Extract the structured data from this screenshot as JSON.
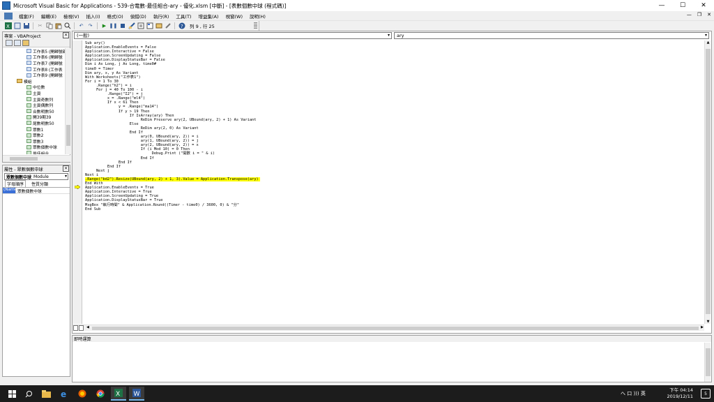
{
  "window": {
    "title": "Microsoft Visual Basic for Applications - 539-合電數-最佳組合-ary - 優化.xlsm [中斷] - [表數個數中球 (程式碼)]",
    "controls": [
      "—",
      "☐",
      "✕"
    ]
  },
  "menubar": {
    "items": [
      "檔案(F)",
      "編輯(E)",
      "檢視(V)",
      "插入(I)",
      "格式(O)",
      "偵錯(D)",
      "執行(R)",
      "工具(T)",
      "增益集(A)",
      "視窗(W)",
      "說明(H)"
    ],
    "mdi_controls": [
      "—",
      "❐",
      "✕"
    ]
  },
  "toolbar": {
    "position_text": "列 9 , 行 25"
  },
  "project_pane": {
    "title": "專案 - VBAProject",
    "tree": [
      {
        "label": "工作表5 (開歸號碼",
        "kind": "sheet"
      },
      {
        "label": "工作表6 (開歸號",
        "kind": "sheet"
      },
      {
        "label": "工作表7 (開歸號",
        "kind": "sheet"
      },
      {
        "label": "工作表8 (工作表",
        "kind": "sheet"
      },
      {
        "label": "工作表9 (開歸號",
        "kind": "sheet"
      },
      {
        "label": "模組",
        "kind": "folder"
      },
      {
        "label": "中位數",
        "kind": "module"
      },
      {
        "label": "主頁",
        "kind": "module"
      },
      {
        "label": "主頁奇數列",
        "kind": "module"
      },
      {
        "label": "主頁偶數列",
        "kind": "module"
      },
      {
        "label": "合數明數50",
        "kind": "module"
      },
      {
        "label": "開39期39",
        "kind": "module"
      },
      {
        "label": "尾數明數50",
        "kind": "module"
      },
      {
        "label": "眾數1",
        "kind": "module"
      },
      {
        "label": "眾數2",
        "kind": "module"
      },
      {
        "label": "眾數3",
        "kind": "module"
      },
      {
        "label": "眾數個數中球",
        "kind": "module"
      },
      {
        "label": "最佳組合",
        "kind": "module"
      }
    ]
  },
  "properties_pane": {
    "title": "屬性 - 眾數個數中球",
    "object_name": "眾數個數中球",
    "object_type": "Module",
    "tabs": [
      "字母順序",
      "性質分類"
    ],
    "row_key": "(Name)",
    "row_value": "眾數個數中球"
  },
  "code_window": {
    "object_combo": "(一般)",
    "proc_combo": "ary",
    "lines": [
      "Sub ary()",
      "Application.EnableEvents = False",
      "Application.Interactive = False",
      "Application.ScreenUpdating = False",
      "Application.DisplayStatusBar = False",
      "Dim i As Long, j As Long, time0#",
      "time0 = Timer",
      "Dim ary, x, y As Variant",
      "With Worksheets(\"工作表1\")",
      "For i = 1 To 30",
      "     .Range(\"h2\") = i",
      "     For j = 40 To 100 - i",
      "          .Range(\"I2\") = j",
      "          x = .Range(\"ml4\")",
      "          If x < 61 Then",
      "               y = .Range(\"ma14\")",
      "               If y > 19 Then",
      "                    If IsArray(ary) Then",
      "                         ReDim Preserve ary(2, UBound(ary, 2) + 1) As Variant",
      "                    Else",
      "                         ReDim ary(2, 0) As Variant",
      "                    End If",
      "                         ary(0, UBound(ary, 2)) = i",
      "                         ary(1, UBound(ary, 2)) = j",
      "                         ary(2, UBound(ary, 2)) = x",
      "                         If (i Mod 10) = 0 Then",
      "                              Debug.Print (\"開數 i = \" & i)",
      "                         End If",
      "               End If",
      "          End If",
      "     Next j",
      "Next i",
      ".Range(\"bd2\").Resize(UBound(ary, 2) + 1, 3).Value = Application.Transpose(ary)",
      "End With",
      "Application.EnableEvents = True",
      "Application.Interactive = True",
      "Application.ScreenUpdating = True",
      "Application.DisplayStatusBar = True",
      "MsgBox \"執行時間\" & Application.Round((Timer - time0) / 3600, 0) & \"分\"",
      "End Sub"
    ],
    "highlighted_line_index": 32,
    "highlight_color": "#ffff00",
    "execution_arrow_color": "#ffff00"
  },
  "immediate_window": {
    "title": "即時運算"
  },
  "taskbar": {
    "tray_text": "へ 口 ))) 英",
    "time": "下午 04:14",
    "date": "2019/12/11",
    "notification_count": "5",
    "apps": [
      "start",
      "search",
      "file-explorer",
      "edge",
      "firefox",
      "chrome",
      "excel",
      "word"
    ]
  }
}
